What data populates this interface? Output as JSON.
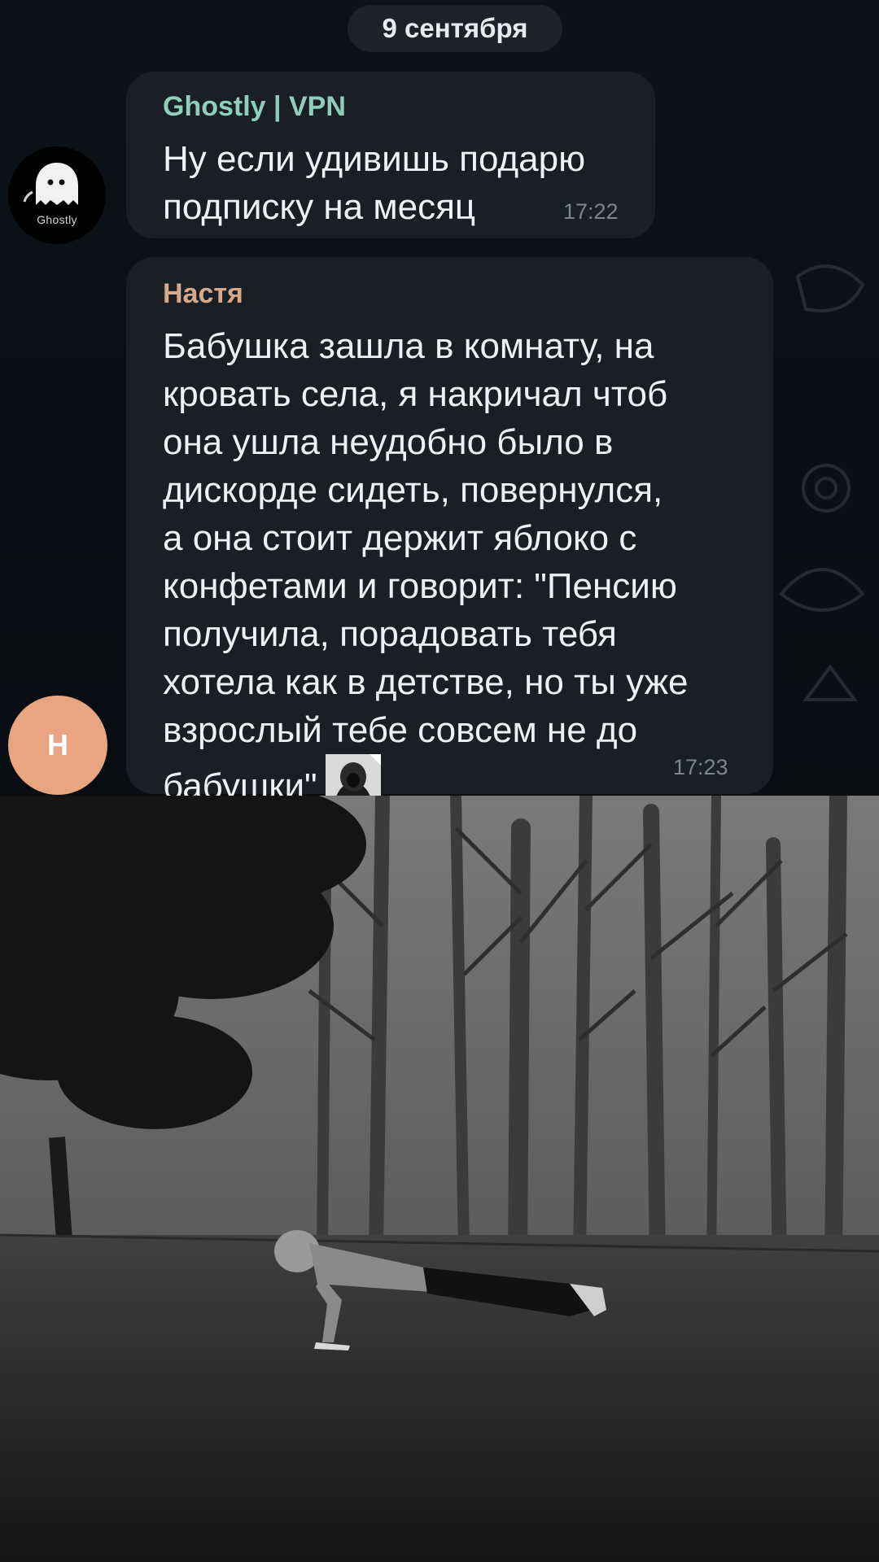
{
  "chat": {
    "date": "9 сентября",
    "messages": [
      {
        "sender": "Ghostly | VPN",
        "text": "Ну если удивишь подарю\nподписку на месяц",
        "time": "17:22",
        "avatar_label": "Ghostly",
        "avatar_icon": "ghost-icon"
      },
      {
        "sender": "Настя",
        "text": "Бабушка зашла в комнату, на\nкровать села, я накричал чтоб\nона ушла неудобно было в\nдискорде сидеть, повернулся,\nа она стоит держит яблоко с\nконфетами и говорит: \"Пенсию\nполучила, порадовать тебя\nхотела как в детстве, но ты уже\nвзрослый тебе совсем не до\nбабушки\"",
        "time": "17:23",
        "avatar_initial": "Н",
        "avatar_color": "#e9a581",
        "sticker": "hooded-figure-sticker"
      }
    ]
  },
  "colors": {
    "bubble": "#1a1f26",
    "sender_ghostly": "#8fcfb9",
    "sender_nastya": "#d5a98a",
    "timestamp": "#7d848d"
  },
  "photo": {
    "scene": "grayscale-foggy-forest-pushup"
  }
}
